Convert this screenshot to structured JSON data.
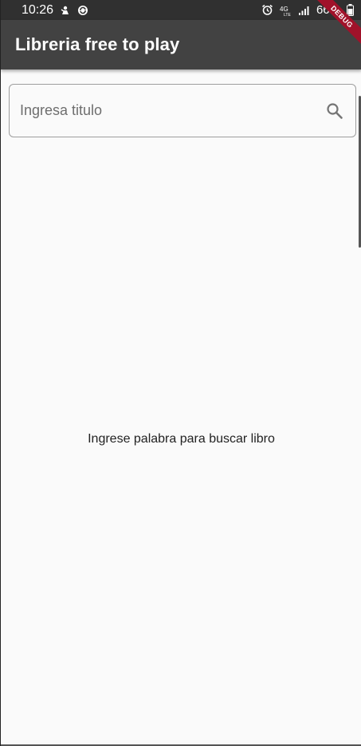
{
  "status_bar": {
    "time": "10:26",
    "battery": "66%",
    "network": "4G",
    "left_icons": [
      "notification-icon",
      "sync-icon"
    ],
    "right_icons": [
      "alarm-icon",
      "network-4g-icon",
      "signal-icon",
      "battery-icon"
    ]
  },
  "app_bar": {
    "title": "Libreria free to play",
    "background": "#424242"
  },
  "debug_banner": {
    "label": "DEBUG",
    "color": "#a0122a"
  },
  "search": {
    "placeholder": "Ingresa titulo",
    "value": "",
    "icon": "search-icon"
  },
  "main": {
    "empty_message": "Ingrese palabra para buscar libro"
  }
}
